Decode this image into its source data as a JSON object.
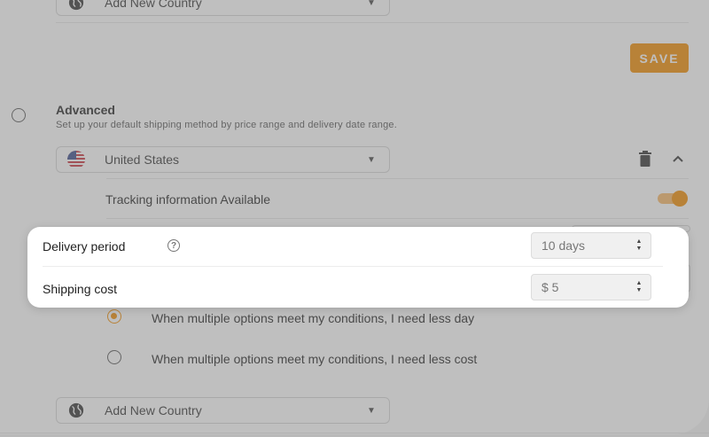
{
  "top_country": {
    "placeholder": "Add New Country"
  },
  "save_label": "SAVE",
  "advanced": {
    "title": "Advanced",
    "description": "Set up your default shipping method by price range and delivery date range."
  },
  "country_select": {
    "value": "United States"
  },
  "tracking": {
    "label": "Tracking information Available",
    "enabled": true
  },
  "delivery": {
    "label": "Delivery period",
    "value": "10 days"
  },
  "shipping": {
    "label": "Shipping cost",
    "value": "$ 5"
  },
  "options": [
    {
      "label": "When multiple options meet my conditions, I need less day",
      "selected": true
    },
    {
      "label": "When multiple options meet my conditions, I need less cost",
      "selected": false
    }
  ],
  "bottom_country": {
    "placeholder": "Add New Country"
  },
  "colors": {
    "accent": "#f28c00",
    "overlay": "#787878"
  },
  "icons": [
    "globe-icon",
    "us-flag-icon",
    "chevron-down-icon",
    "trash-icon",
    "chevron-up-icon",
    "help-circle-icon",
    "stepper-icon"
  ]
}
